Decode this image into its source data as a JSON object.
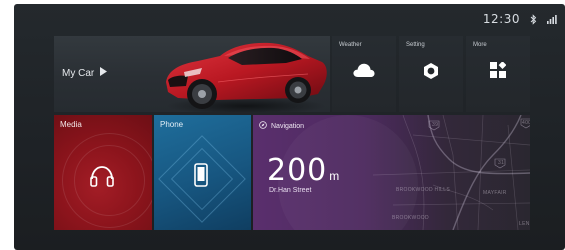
{
  "status": {
    "time": "12:30",
    "bluetooth_icon": "bluetooth-icon",
    "signal_icon": "signal-icon"
  },
  "my_car": {
    "label": "My Car",
    "icon": "play-arrow-icon"
  },
  "tiles": {
    "weather": {
      "label": "Weather",
      "icon": "cloud-icon"
    },
    "setting": {
      "label": "Setting",
      "icon": "hexagon-nut-icon"
    },
    "more": {
      "label": "More",
      "icon": "apps-grid-icon"
    }
  },
  "media": {
    "label": "Media",
    "icon": "headphones-icon"
  },
  "phone": {
    "label": "Phone",
    "icon": "smartphone-icon"
  },
  "navigation": {
    "label": "Navigation",
    "icon": "compass-icon",
    "distance_value": "200",
    "distance_unit": "m",
    "street": "Dr.Han Street",
    "map_labels": {
      "route_39": "39",
      "route_400": "400",
      "route_31": "31",
      "brookwood_hills": "BROOKWOOD HILLS",
      "brookwood": "BROOKWOOD",
      "mayfair": "MAYFAIR",
      "len": "LEN"
    }
  },
  "colors": {
    "screen_bg": "#22272b",
    "media_red": "#8c141c",
    "phone_blue": "#175680",
    "nav_purple": "#5a2f6d",
    "car_red": "#c8212c"
  }
}
